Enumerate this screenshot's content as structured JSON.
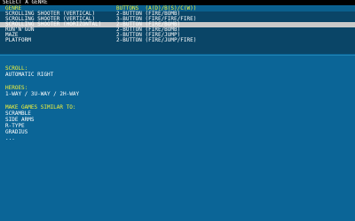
{
  "window": {
    "title": "SELECT A GENRE"
  },
  "table": {
    "headers": {
      "genre": "GENRE",
      "buttons": "BUTTONS  (A(D)/B(S)/C(W))"
    },
    "rows": [
      {
        "genre": "SCROLLING SHOOTER (VERTICAL)",
        "buttons": "2-BUTTON (FIRE/BOMB)"
      },
      {
        "genre": "SCROLLING SHOOTER (VERTICAL)",
        "buttons": "3-BUTTON (FIRE/FIRE/FIRE)"
      },
      {
        "genre": "SCROLLING SHOOTER (HORIZONTAL)",
        "buttons": "2-BUTTON (FIRE/BOMB)"
      },
      {
        "genre": "RUN'N'GUN",
        "buttons": "2-BUTTON (FIRE/BOMB)"
      },
      {
        "genre": "MAZE",
        "buttons": "2-BUTTON (FIRE/JUMP)"
      },
      {
        "genre": "PLATFORM",
        "buttons": "2-BUTTON (FIRE/JUMP/FIRE)"
      }
    ],
    "selected_index": 2
  },
  "details": {
    "scroll": {
      "label": "SCROLL:",
      "value": "AUTOMATIC RIGHT"
    },
    "heroes": {
      "label": "HEROES:",
      "value": "1-WAY / 3U-WAY / 2H-WAY"
    },
    "similar": {
      "label": "MAKE GAMES SIMILAR TO:",
      "items": [
        "SCRAMBLE",
        "SIDE ARMS",
        "R-TYPE",
        "GRADIUS",
        "..."
      ]
    }
  },
  "colors": {
    "background": "#0b6597",
    "list_background": "#0a4567",
    "header_text": "#f2f23a",
    "selected_row": "#c9c9c9",
    "title_bar": "#000000"
  }
}
